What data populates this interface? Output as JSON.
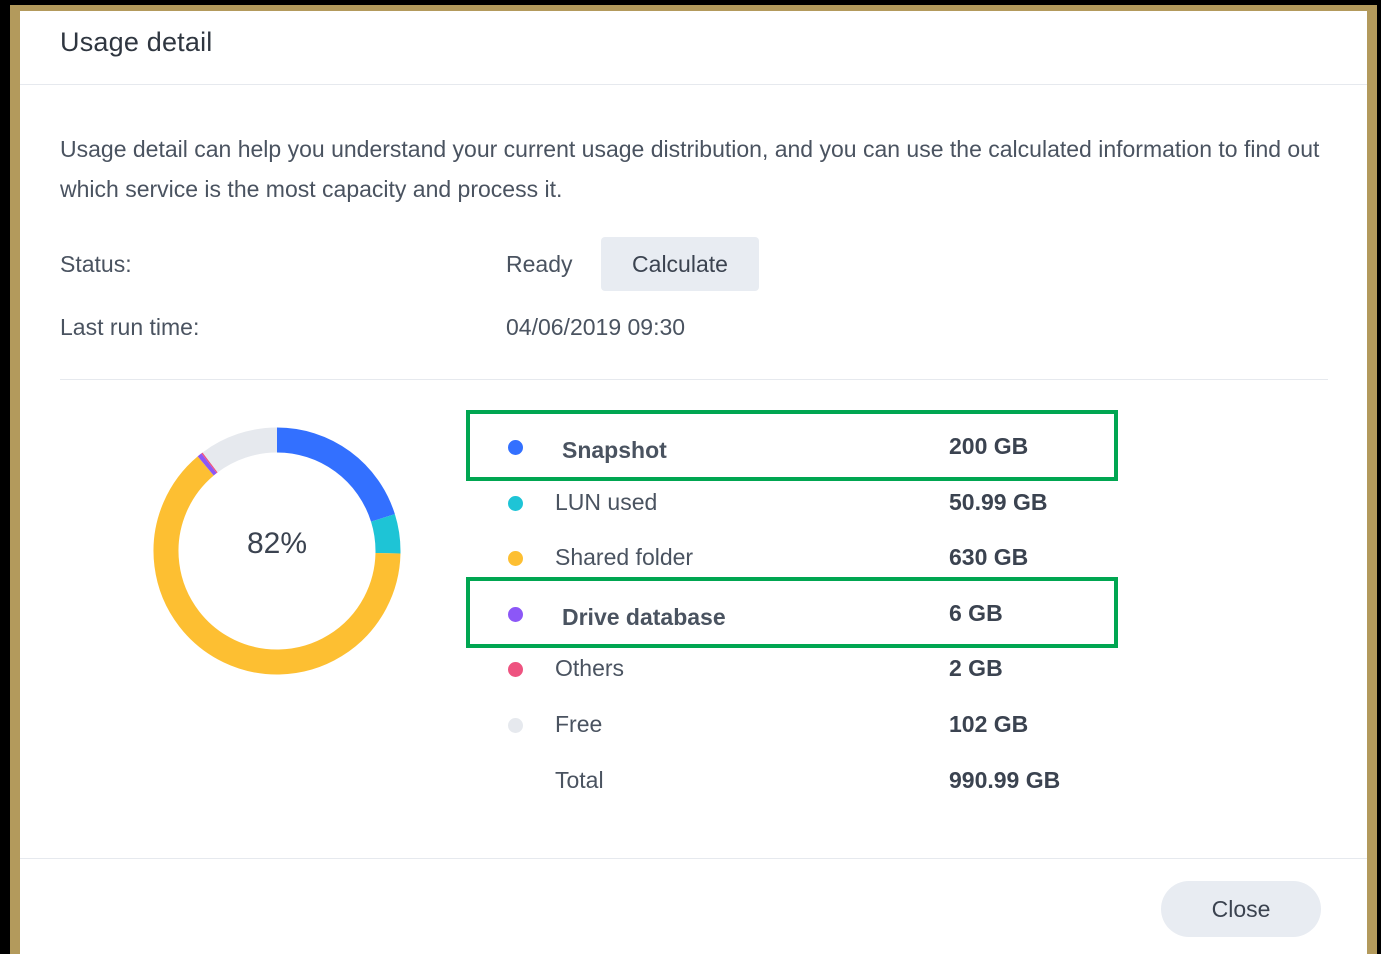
{
  "dialog": {
    "title": "Usage detail",
    "description": "Usage detail can help you understand your current usage distribution, and you can use the calculated information to find out which service is the most capacity and process it.",
    "status_label": "Status:",
    "status_value": "Ready",
    "calculate_label": "Calculate",
    "last_run_label": "Last run time:",
    "last_run_value": "04/06/2019 09:30",
    "close_label": "Close"
  },
  "chart_data": {
    "type": "pie",
    "center_label": "82%",
    "series": [
      {
        "name": "Snapshot",
        "label": "200 GB",
        "value": 200,
        "color": "#3370ff"
      },
      {
        "name": "LUN used",
        "label": "50.99 GB",
        "value": 50.99,
        "color": "#1ec4d6"
      },
      {
        "name": "Shared folder",
        "label": "630 GB",
        "value": 630,
        "color": "#fdbf32"
      },
      {
        "name": "Drive database",
        "label": "6 GB",
        "value": 6,
        "color": "#8c57f7"
      },
      {
        "name": "Others",
        "label": "2 GB",
        "value": 2,
        "color": "#ee5380"
      },
      {
        "name": "Free",
        "label": "102 GB",
        "value": 102,
        "color": "#e6e9ee"
      }
    ],
    "total": {
      "name": "Total",
      "label": "990.99 GB"
    }
  },
  "highlight_color": "#00a651"
}
